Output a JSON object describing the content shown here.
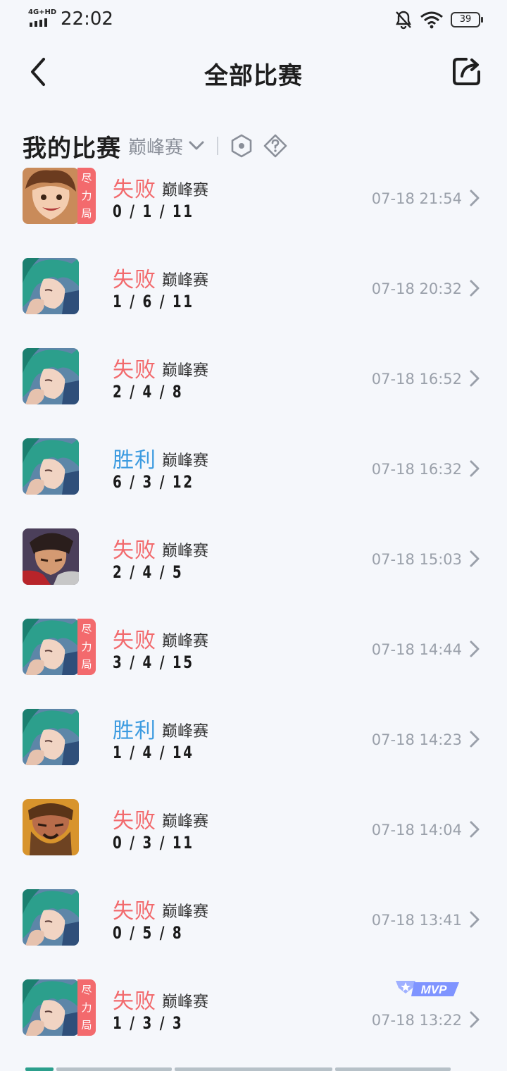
{
  "status": {
    "network": "4G+HD",
    "time": "22:02",
    "battery": "39"
  },
  "header": {
    "title": "全部比赛"
  },
  "section": {
    "title": "我的比赛",
    "filter": "巅峰赛"
  },
  "matches": [
    {
      "result": "失败",
      "mode": "巅峰赛",
      "kda": "0 / 1 / 11",
      "time": "07-18 21:54",
      "tag": "尽力局"
    },
    {
      "result": "失败",
      "mode": "巅峰赛",
      "kda": "1 / 6 / 11",
      "time": "07-18 20:32"
    },
    {
      "result": "失败",
      "mode": "巅峰赛",
      "kda": "2 / 4 / 8",
      "time": "07-18 16:52"
    },
    {
      "result": "胜利",
      "mode": "巅峰赛",
      "kda": "6 / 3 / 12",
      "time": "07-18 16:32"
    },
    {
      "result": "失败",
      "mode": "巅峰赛",
      "kda": "2 / 4 / 5",
      "time": "07-18 15:03"
    },
    {
      "result": "失败",
      "mode": "巅峰赛",
      "kda": "3 / 4 / 15",
      "time": "07-18 14:44",
      "tag": "尽力局"
    },
    {
      "result": "胜利",
      "mode": "巅峰赛",
      "kda": "1 / 4 / 14",
      "time": "07-18 14:23"
    },
    {
      "result": "失败",
      "mode": "巅峰赛",
      "kda": "0 / 3 / 11",
      "time": "07-18 14:04"
    },
    {
      "result": "失败",
      "mode": "巅峰赛",
      "kda": "0 / 5 / 8",
      "time": "07-18 13:41"
    },
    {
      "result": "失败",
      "mode": "巅峰赛",
      "kda": "1 / 3 / 3",
      "time": "07-18 13:22",
      "tag": "尽力局",
      "badge": "MVP"
    }
  ],
  "hero_icons": [
    "brown-hair-hero-icon",
    "green-hair-hero-icon",
    "green-hair-hero-icon",
    "green-hair-hero-icon",
    "warrior-hero-icon",
    "green-hair-hero-icon",
    "green-hair-hero-icon",
    "bearded-hero-icon",
    "green-hair-hero-icon",
    "green-hair-hero-icon"
  ],
  "colors": {
    "loss": "#f26a6d",
    "win": "#3c9be0",
    "tag_bg": "#f36a6d",
    "time_text": "#9aa0aa",
    "background": "#f5f7fb"
  }
}
